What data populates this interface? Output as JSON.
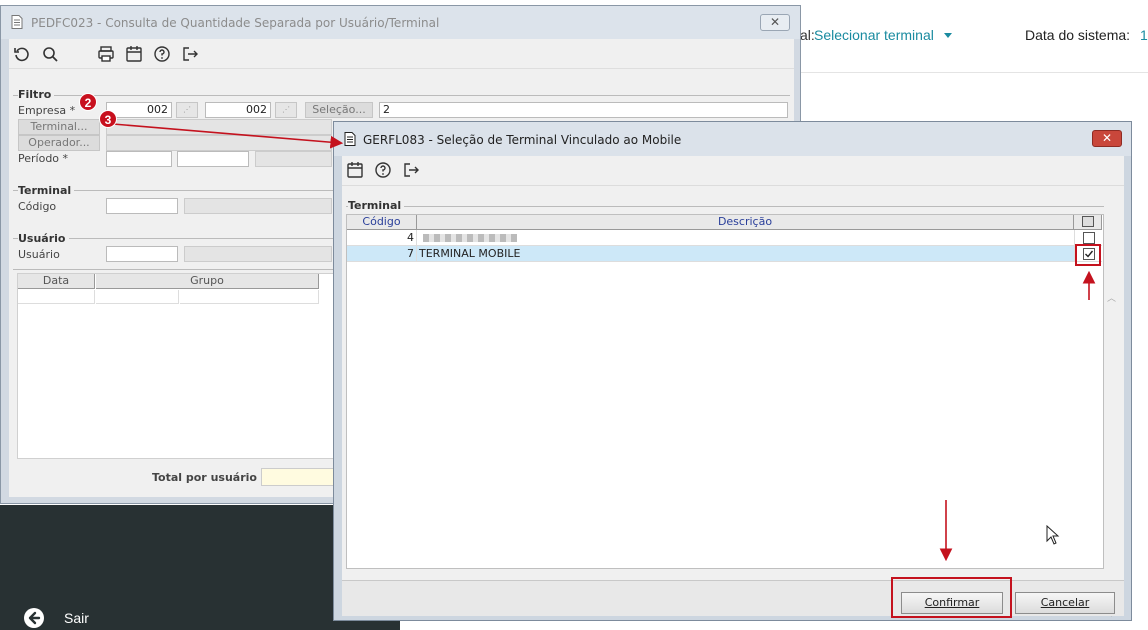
{
  "background": {
    "terminal_label_suffix": "al:",
    "terminal_link": "Selecionar terminal",
    "system_date_label": "Data do sistema:",
    "system_date_value_partial": "1",
    "sair_label": "Sair",
    "accent_color": "#1a8ba0"
  },
  "window1": {
    "title": "PEDFC023 - Consulta de Quantidade Separada por Usuário/Terminal",
    "close_label": "✕",
    "toolbar": [
      "refresh-icon",
      "search-icon",
      "print-icon",
      "calendar-icon",
      "help-icon",
      "exit-icon"
    ],
    "filtro": {
      "group_label": "Filtro",
      "empresa_label": "Empresa *",
      "empresa_from": "002",
      "empresa_to": "002",
      "selecao_button": "Seleção...",
      "selecao_value": "2",
      "terminal_button": "Terminal...",
      "operador_button": "Operador...",
      "periodo_label": "Período *"
    },
    "terminal_group": {
      "group_label": "Terminal",
      "codigo_label": "Código"
    },
    "usuario_group": {
      "group_label": "Usuário",
      "usuario_label": "Usuário"
    },
    "grid": {
      "columns": [
        "Data",
        "Grupo"
      ]
    },
    "total_label": "Total por usuário"
  },
  "annotations": {
    "badge_2": "2",
    "badge_3": "3",
    "annotation_color": "#c4121e"
  },
  "window2": {
    "title": "GERFL083 - Seleção de Terminal Vinculado ao Mobile",
    "close_label": "✕",
    "toolbar": [
      "calendar-icon",
      "help-icon",
      "exit-icon"
    ],
    "group_label": "Terminal",
    "columns": {
      "codigo": "Código",
      "descricao": "Descrição"
    },
    "rows": [
      {
        "codigo": "4",
        "descricao": "",
        "checked": false,
        "selected": false
      },
      {
        "codigo": "7",
        "descricao": "TERMINAL MOBILE",
        "checked": true,
        "selected": true
      }
    ],
    "confirm_button": "Confirmar",
    "cancel_button": "Cancelar",
    "selected_row_color": "#cde8f8"
  }
}
